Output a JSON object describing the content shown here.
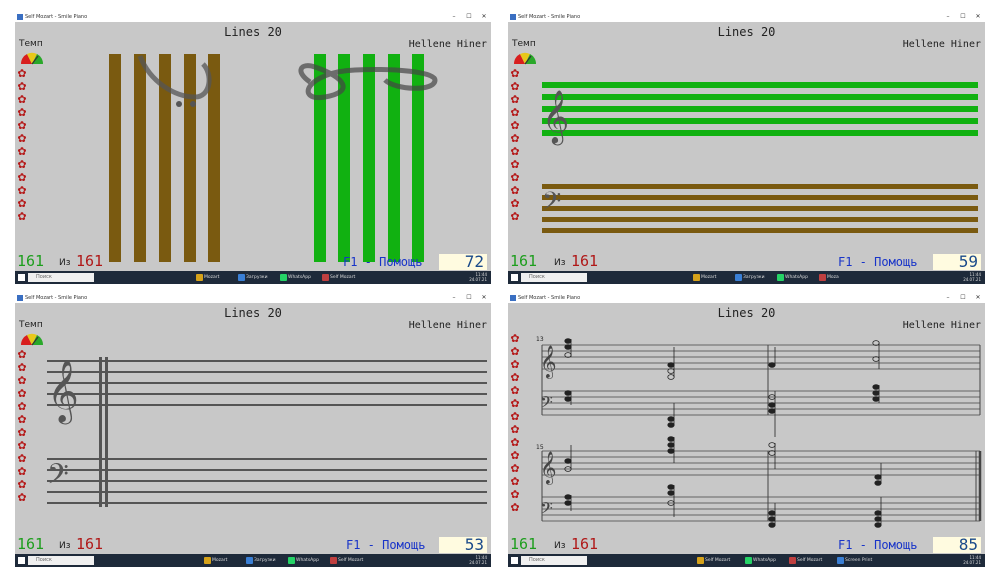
{
  "windows": [
    {
      "title": "Self Mozart - Smile Piano",
      "song": "Lines 20",
      "author": "Hellene Hiner",
      "tempo_label": "Темп",
      "progress_current": "161",
      "progress_of": "Из",
      "progress_total": "161",
      "help": "F1 - Помощь",
      "score": "72"
    },
    {
      "title": "Self Mozart - Smile Piano",
      "song": "Lines 20",
      "author": "Hellene Hiner",
      "tempo_label": "Темп",
      "progress_current": "161",
      "progress_of": "Из",
      "progress_total": "161",
      "help": "F1 - Помощь",
      "score": "59"
    },
    {
      "title": "Self Mozart - Smile Piano",
      "song": "Lines 20",
      "author": "Hellene Hiner",
      "tempo_label": "Темп",
      "progress_current": "161",
      "progress_of": "Из",
      "progress_total": "161",
      "help": "F1 - Помощь",
      "score": "53"
    },
    {
      "title": "Self Mozart - Smile Piano",
      "song": "Lines 20",
      "author": "Hellene Hiner",
      "tempo_label": "Темп",
      "progress_current": "161",
      "progress_of": "Из",
      "progress_total": "161",
      "help": "F1 - Помощь",
      "score": "85",
      "measures": [
        "13",
        "15"
      ]
    }
  ],
  "taskbar": {
    "search_placeholder": "Поиск",
    "apps": [
      "Mozart",
      "Self Mozart",
      "Загрузки",
      "Self Mozart",
      "WhatsApp",
      "Self Mozart",
      "Moza",
      "Self Mozart",
      "Screen Print"
    ],
    "clock_time": "11:44",
    "clock_date": "24.07.21",
    "lang": "РУС"
  },
  "colors": {
    "brown": "#7a5a10",
    "green": "#11b111",
    "bg": "#c8c8c8",
    "count_green": "#1d9e1d",
    "count_red": "#b01818",
    "help_blue": "#1834c9",
    "flower": "#b51a1a"
  }
}
